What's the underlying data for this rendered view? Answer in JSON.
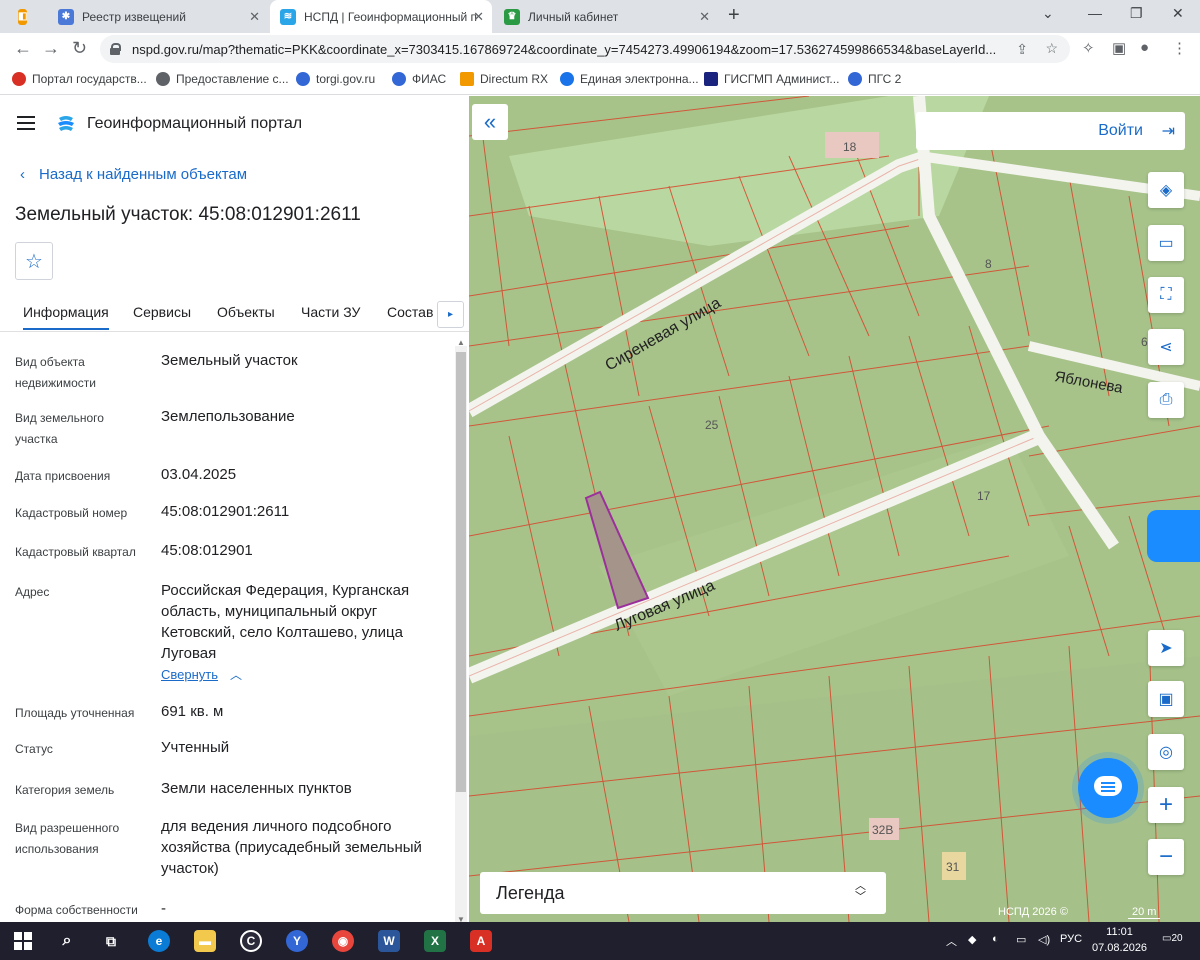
{
  "browser": {
    "tabs": [
      {
        "title": "Реестр извещений",
        "icon_color": "#4a79d8"
      },
      {
        "title": "НСПД | Геоинформационный п",
        "icon_color": "#2aa6e8"
      },
      {
        "title": "Личный кабинет",
        "icon_color": "#2b9a45"
      }
    ],
    "url": "nspd.gov.ru/map?thematic=PKK&coordinate_x=7303415.167869724&coordinate_y=7454273.49906194&zoom=17.536274599866534&baseLayerId...",
    "bookmarks": [
      {
        "label": "Портал государств...",
        "color": "#d93025"
      },
      {
        "label": "Предоставление с...",
        "color": "#5f6368"
      },
      {
        "label": "torgi.gov.ru",
        "color": "#3367d6"
      },
      {
        "label": "ФИАС",
        "color": "#3367d6"
      },
      {
        "label": "Directum RX",
        "color": "#f29900"
      },
      {
        "label": "Единая электронна...",
        "color": "#1a73e8"
      },
      {
        "label": "ГИСГМП Админист...",
        "color": "#1a237e"
      },
      {
        "label": "ПГС 2",
        "color": "#3367d6"
      }
    ]
  },
  "header": {
    "title": "Геоинформационный портал"
  },
  "nav": {
    "back_label": "Назад к найденным объектам"
  },
  "object": {
    "title": "Земельный участок: 45:08:012901:2611"
  },
  "panel_tabs": [
    "Информация",
    "Сервисы",
    "Объекты",
    "Части ЗУ",
    "Состав"
  ],
  "info": [
    {
      "label": "Вид объекта недвижимости",
      "value": "Земельный участок"
    },
    {
      "label": "Вид земельного участка",
      "value": "Землепользование"
    },
    {
      "label": "Дата присвоения",
      "value": "03.04.2025"
    },
    {
      "label": "Кадастровый номер",
      "value": "45:08:012901:2611"
    },
    {
      "label": "Кадастровый квартал",
      "value": "45:08:012901"
    },
    {
      "label": "Адрес",
      "value": "Российская Федерация, Курганская область, муниципальный округ Кетовский, село Колташево, улица Луговая"
    },
    {
      "label": "Площадь уточненная",
      "value": "691 кв. м"
    },
    {
      "label": "Статус",
      "value": "Учтенный"
    },
    {
      "label": "Категория земель",
      "value": "Земли населенных пунктов"
    },
    {
      "label": "Вид разрешенного использования",
      "value": "для ведения личного подсобного хозяйства (приусадебный земельный участок)"
    },
    {
      "label": "Форма собственности",
      "value": "-"
    }
  ],
  "collapse_label": "Свернуть",
  "map": {
    "login_label": "Войти",
    "legend_label": "Легенда",
    "copyright": "НСПД 2026 ©",
    "scale": "20 m",
    "streets": [
      "Сиреневая улица",
      "Луговая улица",
      "Яблонева"
    ],
    "numbers": [
      "18",
      "8",
      "25",
      "17",
      "32В",
      "31",
      "6"
    ]
  },
  "taskbar": {
    "lang": "РУС",
    "time": "11:01",
    "date": "07.08.2026",
    "notif": "20"
  }
}
